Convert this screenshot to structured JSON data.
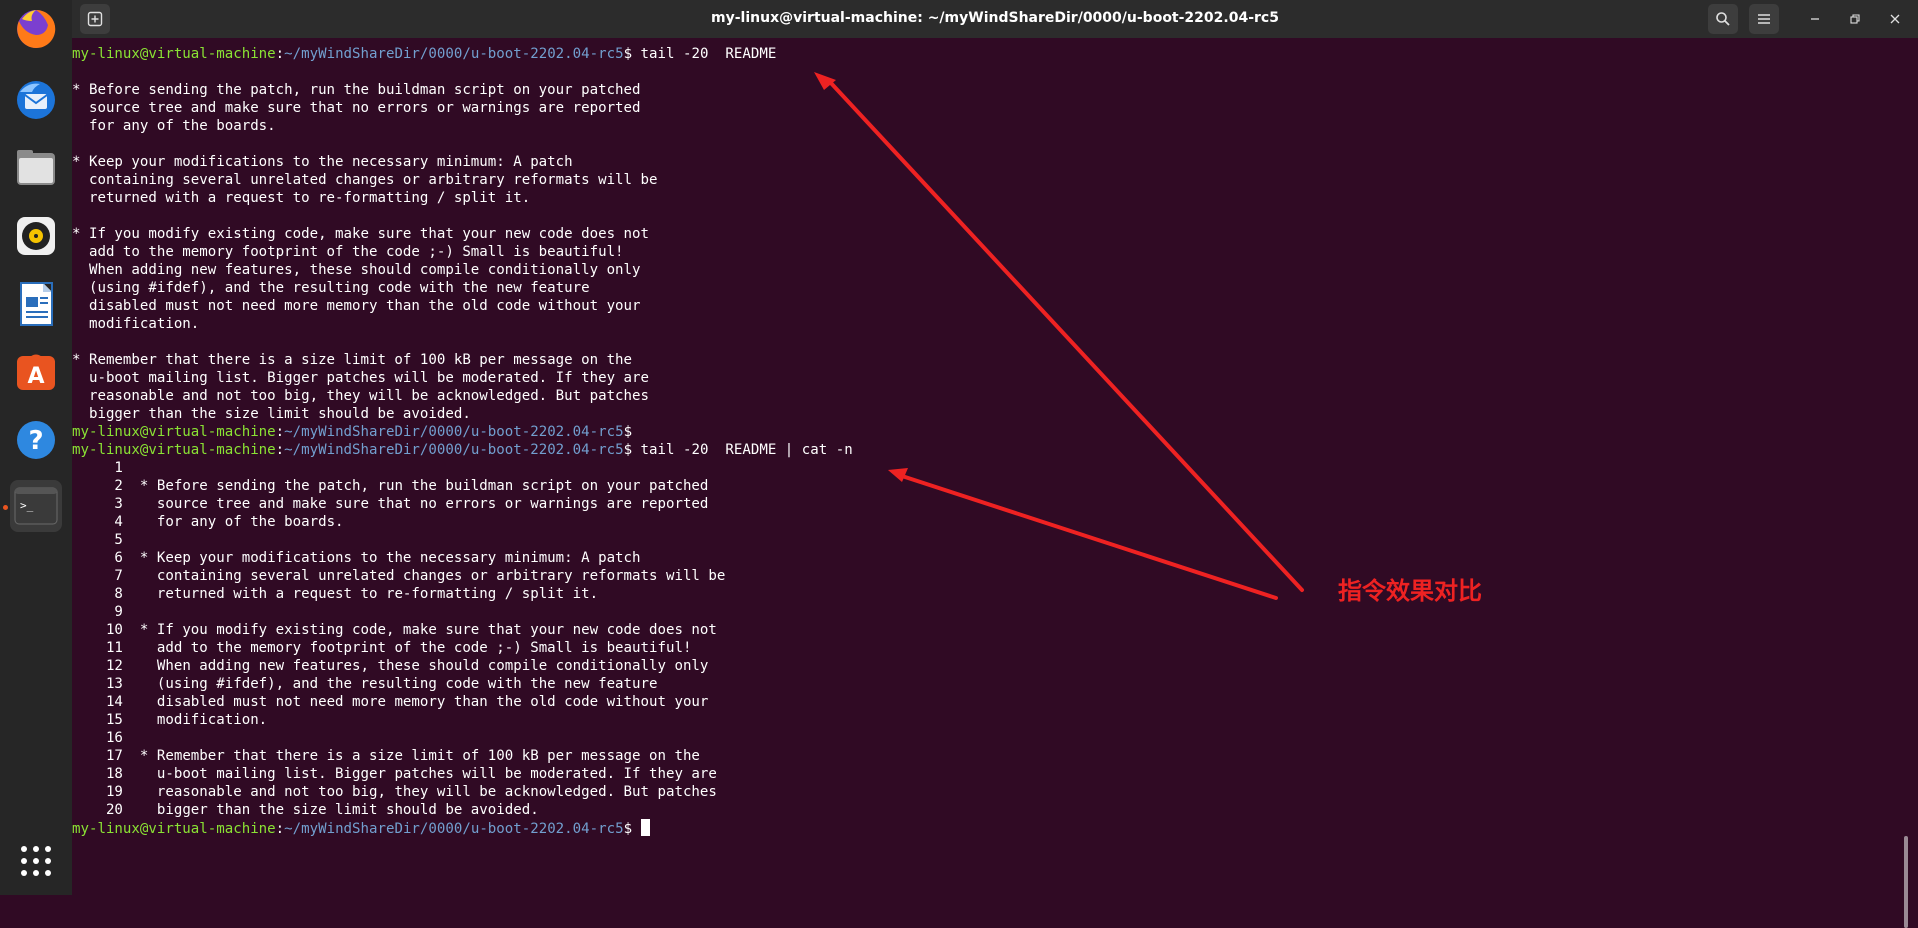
{
  "window": {
    "title": "my-linux@virtual-machine: ~/myWindShareDir/0000/u-boot-2202.04-rc5"
  },
  "dock": {
    "items": [
      {
        "name": "firefox-icon"
      },
      {
        "name": "thunderbird-icon"
      },
      {
        "name": "files-icon"
      },
      {
        "name": "rhythmbox-icon"
      },
      {
        "name": "libreoffice-writer-icon"
      },
      {
        "name": "software-center-icon"
      },
      {
        "name": "help-icon"
      },
      {
        "name": "terminal-icon"
      },
      {
        "name": "app-grid-icon"
      }
    ]
  },
  "prompt": {
    "user": "my-linux@virtual-machine",
    "sep": ":",
    "path": "~/myWindShareDir/0000/u-boot-2202.04-rc5",
    "sym": "$ "
  },
  "commands": {
    "first": "tail -20  README",
    "second": "tail -20  README | cat -n",
    "third": ""
  },
  "output1": [
    "",
    "* Before sending the patch, run the buildman script on your patched",
    "  source tree and make sure that no errors or warnings are reported",
    "  for any of the boards.",
    "",
    "* Keep your modifications to the necessary minimum: A patch",
    "  containing several unrelated changes or arbitrary reformats will be",
    "  returned with a request to re-formatting / split it.",
    "",
    "* If you modify existing code, make sure that your new code does not",
    "  add to the memory footprint of the code ;-) Small is beautiful!",
    "  When adding new features, these should compile conditionally only",
    "  (using #ifdef), and the resulting code with the new feature",
    "  disabled must not need more memory than the old code without your",
    "  modification.",
    "",
    "* Remember that there is a size limit of 100 kB per message on the",
    "  u-boot mailing list. Bigger patches will be moderated. If they are",
    "  reasonable and not too big, they will be acknowledged. But patches",
    "  bigger than the size limit should be avoided."
  ],
  "output2": [
    "     1\t",
    "     2\t* Before sending the patch, run the buildman script on your patched",
    "     3\t  source tree and make sure that no errors or warnings are reported",
    "     4\t  for any of the boards.",
    "     5\t",
    "     6\t* Keep your modifications to the necessary minimum: A patch",
    "     7\t  containing several unrelated changes or arbitrary reformats will be",
    "     8\t  returned with a request to re-formatting / split it.",
    "     9\t",
    "    10\t* If you modify existing code, make sure that your new code does not",
    "    11\t  add to the memory footprint of the code ;-) Small is beautiful!",
    "    12\t  When adding new features, these should compile conditionally only",
    "    13\t  (using #ifdef), and the resulting code with the new feature",
    "    14\t  disabled must not need more memory than the old code without your",
    "    15\t  modification.",
    "    16\t",
    "    17\t* Remember that there is a size limit of 100 kB per message on the",
    "    18\t  u-boot mailing list. Bigger patches will be moderated. If they are",
    "    19\t  reasonable and not too big, they will be acknowledged. But patches",
    "    20\t  bigger than the size limit should be avoided."
  ],
  "annotation": {
    "text": "指令效果对比",
    "color": "#ee2222"
  },
  "colors": {
    "background": "#300a24",
    "prompt_user": "#8ae234",
    "prompt_path": "#729fcf",
    "dock": "#262626",
    "titlebar": "#2c2c2c"
  }
}
